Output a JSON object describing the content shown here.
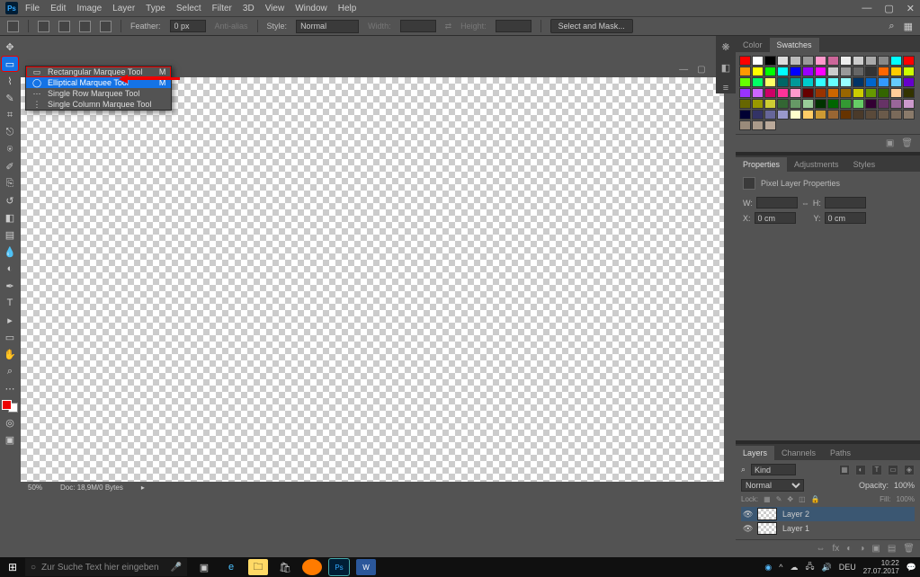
{
  "menu": [
    "File",
    "Edit",
    "Image",
    "Layer",
    "Type",
    "Select",
    "Filter",
    "3D",
    "View",
    "Window",
    "Help"
  ],
  "optbar": {
    "feather_label": "Feather:",
    "feather_value": "0 px",
    "antialias": "Anti-alias",
    "style_label": "Style:",
    "style_value": "Normal",
    "width_label": "Width:",
    "height_label": "Height:",
    "mask_btn": "Select and Mask..."
  },
  "flyout": [
    {
      "icon": "▭",
      "label": "Rectangular Marquee Tool",
      "shortcut": "M",
      "red": true
    },
    {
      "icon": "◯",
      "label": "Elliptical Marquee Tool",
      "shortcut": "M",
      "hl": true
    },
    {
      "icon": "⋯",
      "label": "Single Row Marquee Tool",
      "shortcut": ""
    },
    {
      "icon": "⋮",
      "label": "Single Column Marquee Tool",
      "shortcut": ""
    }
  ],
  "canvas": {
    "zoom": "50%",
    "doc": "Doc: 18,9M/0 Bytes"
  },
  "panels": {
    "color_tabs": [
      "Color",
      "Swatches"
    ],
    "prop_tabs": [
      "Properties",
      "Adjustments",
      "Styles"
    ],
    "prop_title": "Pixel Layer Properties",
    "prop": {
      "w": "W:",
      "h": "H:",
      "x": "X:",
      "y": "Y:",
      "xv": "0 cm",
      "yv": "0 cm",
      "link": "⇔"
    },
    "layer_tabs": [
      "Layers",
      "Channels",
      "Paths"
    ],
    "kind": "Kind",
    "blend": "Normal",
    "opacity_l": "Opacity:",
    "opacity_v": "100%",
    "lock": "Lock:",
    "fill_l": "Fill:",
    "fill_v": "100%",
    "layers": [
      {
        "name": "Layer 2",
        "sel": true
      },
      {
        "name": "Layer 1",
        "sel": false
      }
    ]
  },
  "swatch_colors": [
    "#ff0000",
    "#ffffff",
    "#000000",
    "#dddddd",
    "#bbbbbb",
    "#999999",
    "#ff99cc",
    "#cc6699",
    "#eeeeee",
    "#cccccc",
    "#aaaaaa",
    "#888888",
    "#00ffff",
    "#ff0000",
    "#ff9900",
    "#ffff00",
    "#00ff00",
    "#00ffff",
    "#0000ff",
    "#9900ff",
    "#ff00ff",
    "#cccccc",
    "#999999",
    "#666666",
    "#333333",
    "#ff6600",
    "#ffcc00",
    "#ccff00",
    "#66ff00",
    "#00ff66",
    "#ffff66",
    "#006666",
    "#009999",
    "#00cccc",
    "#33ffff",
    "#66ffff",
    "#99ffff",
    "#003366",
    "#0066cc",
    "#3399ff",
    "#66ccff",
    "#6600cc",
    "#9933ff",
    "#cc66ff",
    "#cc0066",
    "#ff3399",
    "#ff99cc",
    "#660000",
    "#993300",
    "#cc6600",
    "#996600",
    "#cccc00",
    "#669900",
    "#336600",
    "#ffcc99",
    "#333300",
    "#666600",
    "#999900",
    "#cccc33",
    "#336633",
    "#669966",
    "#99cc99",
    "#003300",
    "#006600",
    "#339933",
    "#66cc66",
    "#330033",
    "#663366",
    "#996699",
    "#cc99cc",
    "#000033",
    "#333366",
    "#666699",
    "#9999cc",
    "#ffffcc",
    "#ffcc66",
    "#cc9933",
    "#996633",
    "#663300",
    "#4a3a2a",
    "#5a4a3a",
    "#6a5a4a",
    "#7a6a5a",
    "#8a7a6a",
    "#9a8a7a",
    "#aa9a8a",
    "#baa99a"
  ],
  "taskbar": {
    "search_ph": "Zur Suche Text hier eingeben",
    "lang": "DEU",
    "time": "10:22",
    "date": "27.07.2017"
  }
}
